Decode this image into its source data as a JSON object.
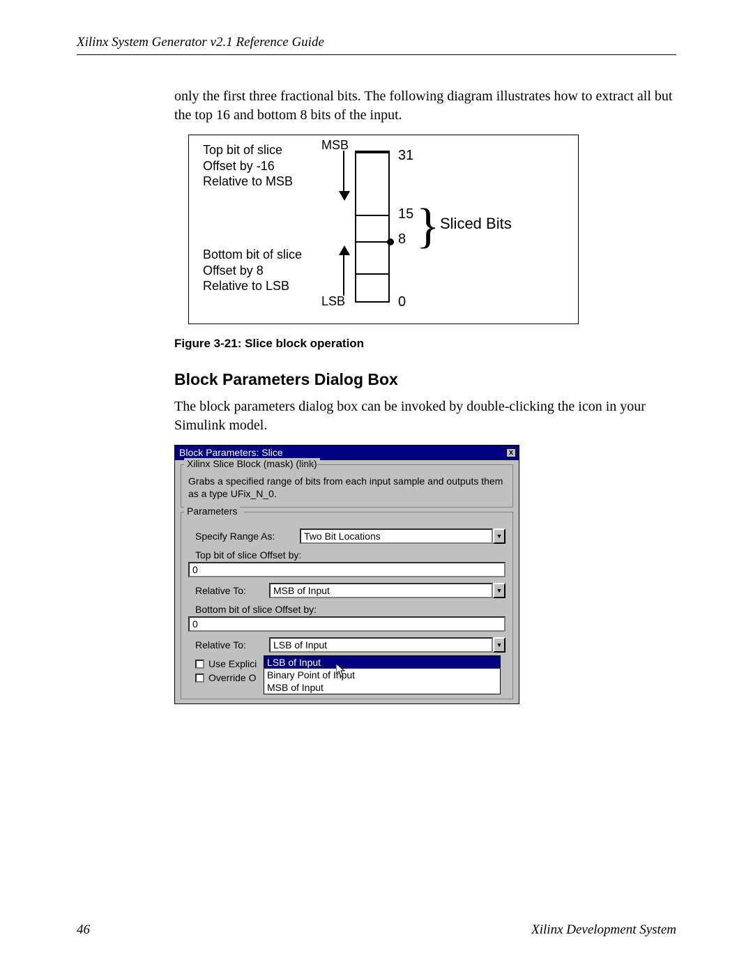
{
  "header": {
    "running_head": "Xilinx System Generator v2.1 Reference Guide"
  },
  "intro_para": "only the first three fractional bits. The following diagram illustrates how to extract all but the top 16 and bottom 8 bits of the input.",
  "diagram": {
    "top_label_l1": "Top bit of slice",
    "top_label_l2": "Offset by -16",
    "top_label_l3": "Relative to MSB",
    "bot_label_l1": "Bottom bit of slice",
    "bot_label_l2": "Offset by 8",
    "bot_label_l3": "Relative to LSB",
    "msb": "MSB",
    "lsb": "LSB",
    "n31": "31",
    "n15": "15",
    "n8": "8",
    "n0": "0",
    "sliced": "Sliced Bits"
  },
  "figure_caption": "Figure 3-21:   Slice block operation",
  "section_heading": "Block Parameters Dialog Box",
  "section_para": "The block parameters dialog box can be invoked by double-clicking the icon in your Simulink model.",
  "dialog": {
    "title": "Block Parameters: Slice",
    "mask_legend": "Xilinx Slice Block (mask) (link)",
    "mask_desc": "Grabs a specified range of bits from each input sample and outputs them as a type UFix_N_0.",
    "params_legend": "Parameters",
    "specify_range_label": "Specify Range As:",
    "specify_range_value": "Two Bit Locations",
    "top_offset_label": "Top bit of slice Offset by:",
    "top_offset_value": "0",
    "relative_to_label": "Relative To:",
    "relative_to_top_value": "MSB of Input",
    "bottom_offset_label": "Bottom bit of slice Offset by:",
    "bottom_offset_value": "0",
    "relative_to_bottom_value": "LSB of Input",
    "chk_use_explicit": "Use Explici",
    "chk_override": "Override O",
    "dropdown_options": {
      "opt1": "LSB of Input",
      "opt2": "Binary Point of Input",
      "opt3": "MSB of Input"
    }
  },
  "footer": {
    "page_no": "46",
    "right": "Xilinx Development System"
  }
}
